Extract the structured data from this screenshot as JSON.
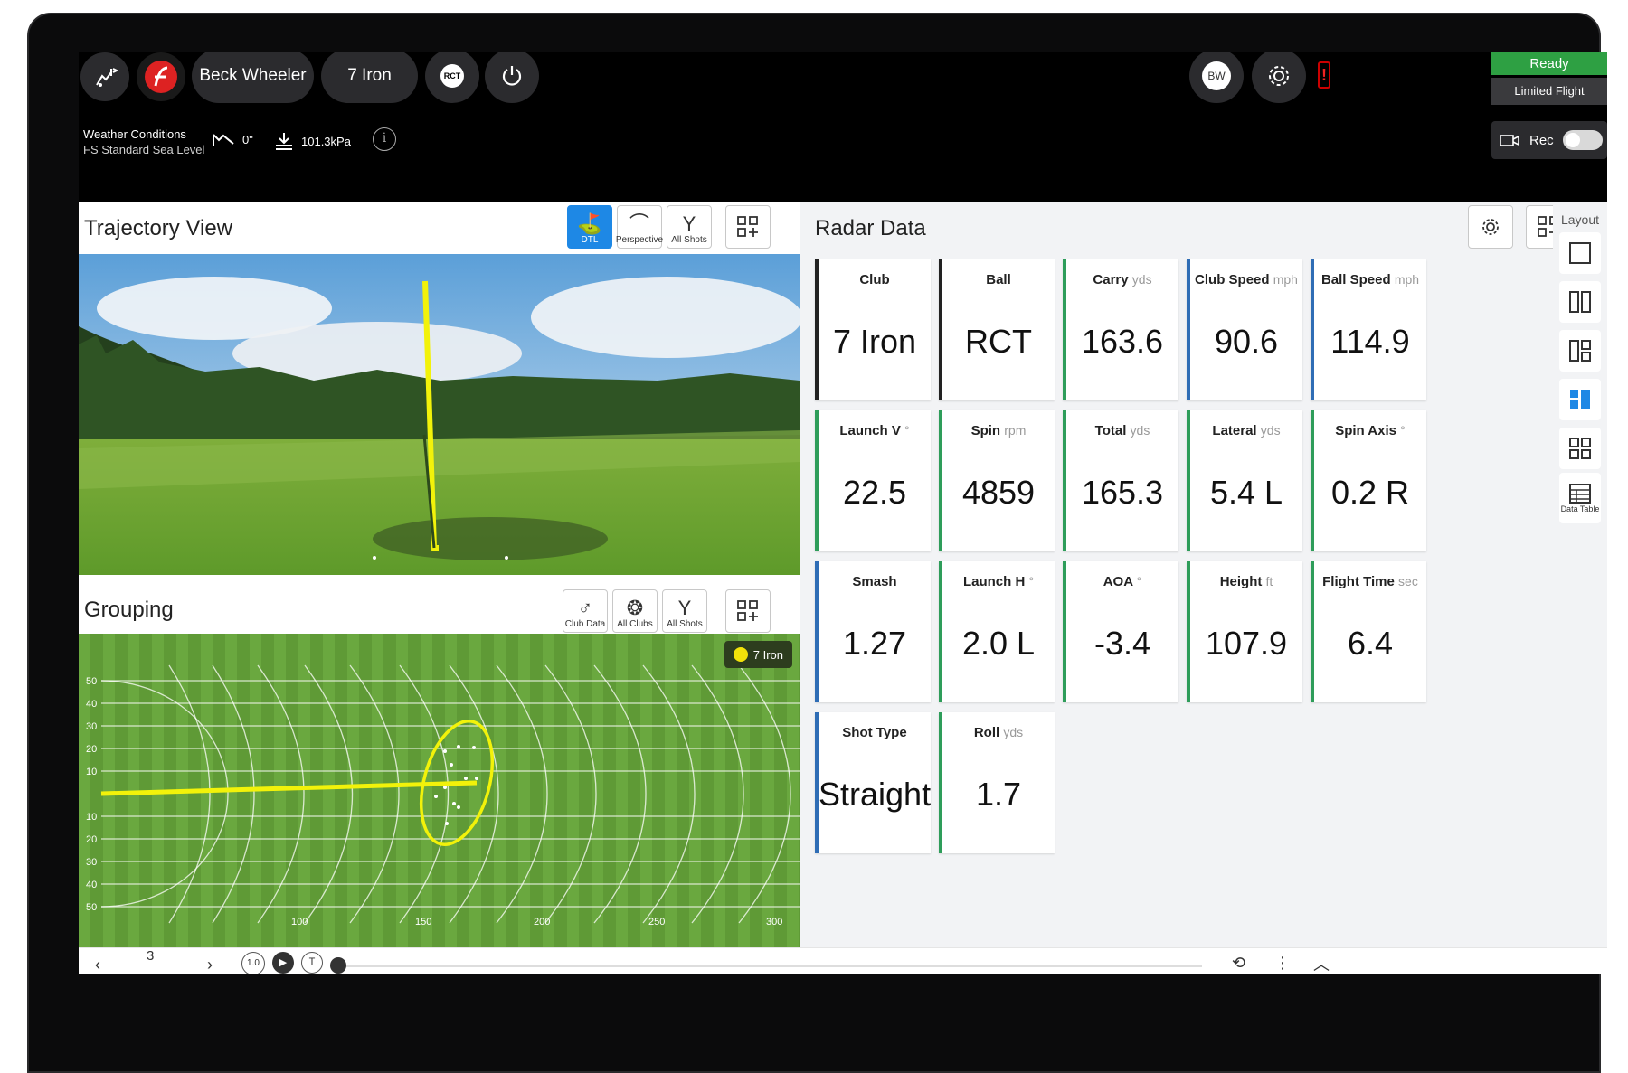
{
  "topbar": {
    "player_name": "Beck Wheeler",
    "club": "7 Iron",
    "ball_badge": "RCT",
    "user_initials": "BW",
    "alert_icon": "!",
    "status_ready": "Ready",
    "status_mode": "Limited Flight",
    "rec_label": "Rec"
  },
  "weather": {
    "title": "Weather Conditions",
    "subtitle": "FS Standard Sea Level",
    "elevation": "0\"",
    "pressure": "101.3kPa"
  },
  "trajectory": {
    "title": "Trajectory View",
    "buttons": [
      "DTL",
      "Perspective",
      "All Shots"
    ]
  },
  "grouping": {
    "title": "Grouping",
    "buttons": [
      "Club Data",
      "All Clubs",
      "All Shots"
    ],
    "legend": "7 Iron",
    "y_ticks_top": [
      "50",
      "40",
      "30",
      "20",
      "10"
    ],
    "y_ticks_bottom": [
      "10",
      "20",
      "30",
      "40",
      "50"
    ],
    "x_ticks": [
      "100",
      "150",
      "200",
      "250",
      "300"
    ]
  },
  "radar": {
    "title": "Radar Data",
    "cards": [
      {
        "label": "Club",
        "unit": "",
        "value": "7 Iron",
        "color": "#222222"
      },
      {
        "label": "Ball",
        "unit": "",
        "value": "RCT",
        "color": "#222222"
      },
      {
        "label": "Carry",
        "unit": "yds",
        "value": "163.6",
        "color": "#2e9d5a"
      },
      {
        "label": "Club Speed",
        "unit": "mph",
        "value": "90.6",
        "color": "#2f6db5"
      },
      {
        "label": "Ball Speed",
        "unit": "mph",
        "value": "114.9",
        "color": "#2f6db5"
      },
      {
        "label": "Launch V",
        "unit": "°",
        "value": "22.5",
        "color": "#2e9d5a"
      },
      {
        "label": "Spin",
        "unit": "rpm",
        "value": "4859",
        "color": "#2e9d5a"
      },
      {
        "label": "Total",
        "unit": "yds",
        "value": "165.3",
        "color": "#2e9d5a"
      },
      {
        "label": "Lateral",
        "unit": "yds",
        "value": "5.4 L",
        "color": "#2e9d5a"
      },
      {
        "label": "Spin Axis",
        "unit": "°",
        "value": "0.2 R",
        "color": "#2e9d5a"
      },
      {
        "label": "Smash",
        "unit": "",
        "value": "1.27",
        "color": "#2f6db5"
      },
      {
        "label": "Launch H",
        "unit": "°",
        "value": "2.0 L",
        "color": "#2e9d5a"
      },
      {
        "label": "AOA",
        "unit": "°",
        "value": "-3.4",
        "color": "#2e9d5a"
      },
      {
        "label": "Height",
        "unit": "ft",
        "value": "107.9",
        "color": "#2e9d5a"
      },
      {
        "label": "Flight Time",
        "unit": "sec",
        "value": "6.4",
        "color": "#2e9d5a"
      },
      {
        "label": "Shot Type",
        "unit": "",
        "value": "Straight",
        "color": "#2f6db5"
      },
      {
        "label": "Roll",
        "unit": "yds",
        "value": "1.7",
        "color": "#2e9d5a"
      }
    ]
  },
  "layout": {
    "title": "Layout",
    "data_table_label": "Data Table"
  },
  "playback": {
    "shot_number": "3",
    "speed_label": "1.0"
  }
}
